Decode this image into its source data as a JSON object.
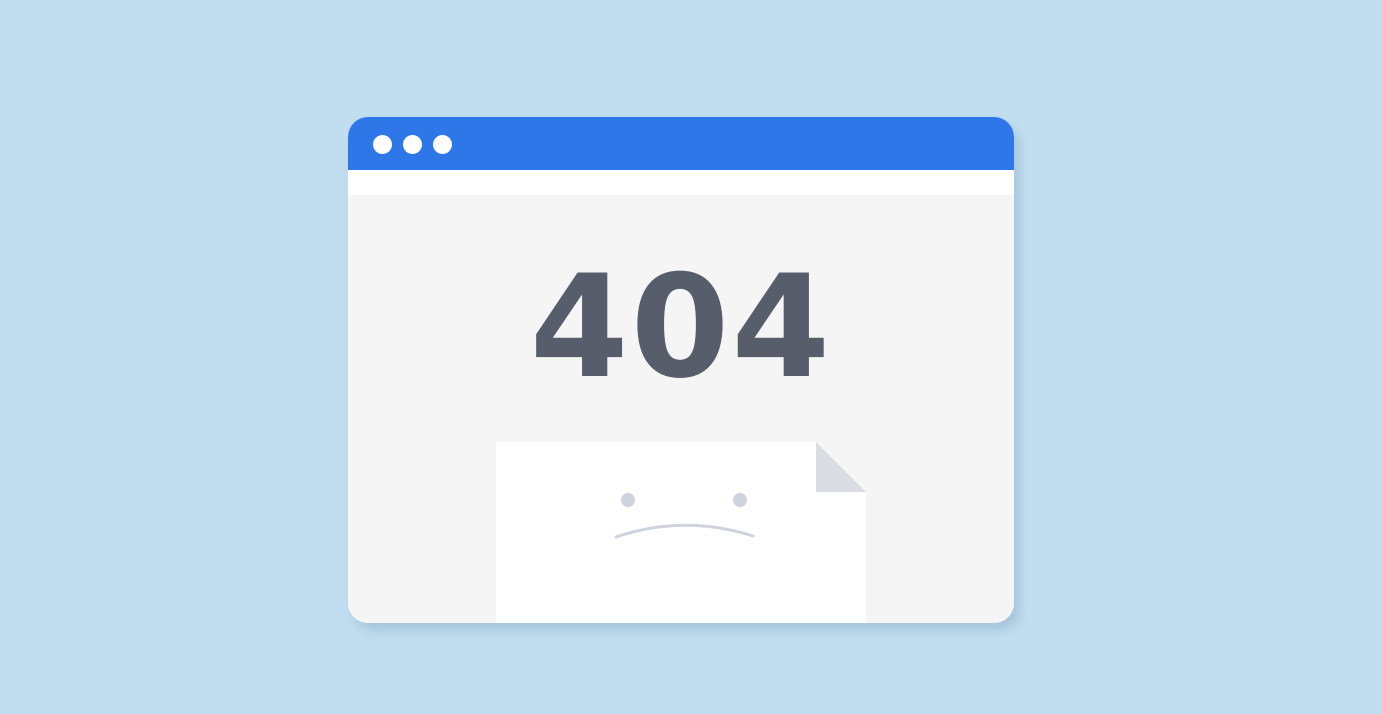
{
  "browser": {
    "window_dots": [
      "dot",
      "dot",
      "dot"
    ],
    "error_code": "404",
    "illustration": {
      "icon": "sad-document-icon"
    }
  },
  "colors": {
    "background": "#c1def0",
    "title_bar": "#2e77e8",
    "content_bg": "#f5f5f5",
    "error_text": "#575d6b",
    "document_fold": "#d9dce3",
    "face": "#cfd3dd"
  }
}
